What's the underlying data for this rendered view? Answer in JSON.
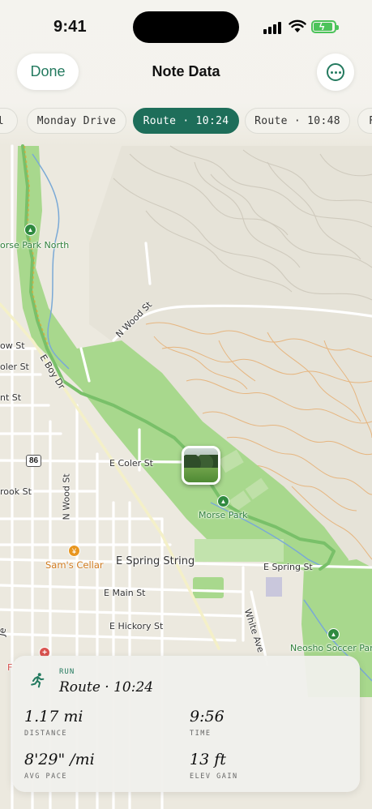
{
  "status_bar": {
    "time": "9:41"
  },
  "nav": {
    "done_label": "Done",
    "title": "Note Data",
    "more_icon": "ellipsis-circle-icon"
  },
  "chips": [
    {
      "label": "l",
      "active": false
    },
    {
      "label": "Monday Drive",
      "active": false
    },
    {
      "label": "Route · 10:24",
      "active": true
    },
    {
      "label": "Route · 10:48",
      "active": false
    },
    {
      "label": "F",
      "active": false
    }
  ],
  "map": {
    "labels": {
      "morse_park_north": "orse Park North",
      "n_wood_st_top": "N Wood St",
      "ow_st": "ow St",
      "oler_st": "oler St",
      "nt_st": "nt St",
      "e_boy_dr": "E Boy Dr",
      "hwy_86": "86",
      "e_coler_st": "E Coler St",
      "rook_st": "rook St",
      "n_wood_st_bottom": "N Wood St",
      "morse_park": "Morse Park",
      "sams_cellar": "Sam's Cellar",
      "e_spring_string": "E Spring String",
      "e_spring_st": "E Spring St",
      "e_main_st": "E Main St",
      "e_hickory_st": "E Hickory St",
      "white_ave": "White Ave",
      "neosho_soccer_park": "Neosho Soccer Park",
      "je": "Je",
      "f_edge": "F"
    },
    "colors": {
      "route": "#7dc36b",
      "park": "#a6d78c",
      "water": "#7aa9d6",
      "contour": "#e2b27a"
    }
  },
  "activity": {
    "kind": "RUN",
    "title": "Route · 10:24",
    "stats": [
      {
        "value": "1.17 mi",
        "label": "DISTANCE"
      },
      {
        "value": "9:56",
        "label": "TIME"
      },
      {
        "value": "8'29\" /mi",
        "label": "AVG PACE"
      },
      {
        "value": "13 ft",
        "label": "ELEV GAIN"
      }
    ]
  }
}
